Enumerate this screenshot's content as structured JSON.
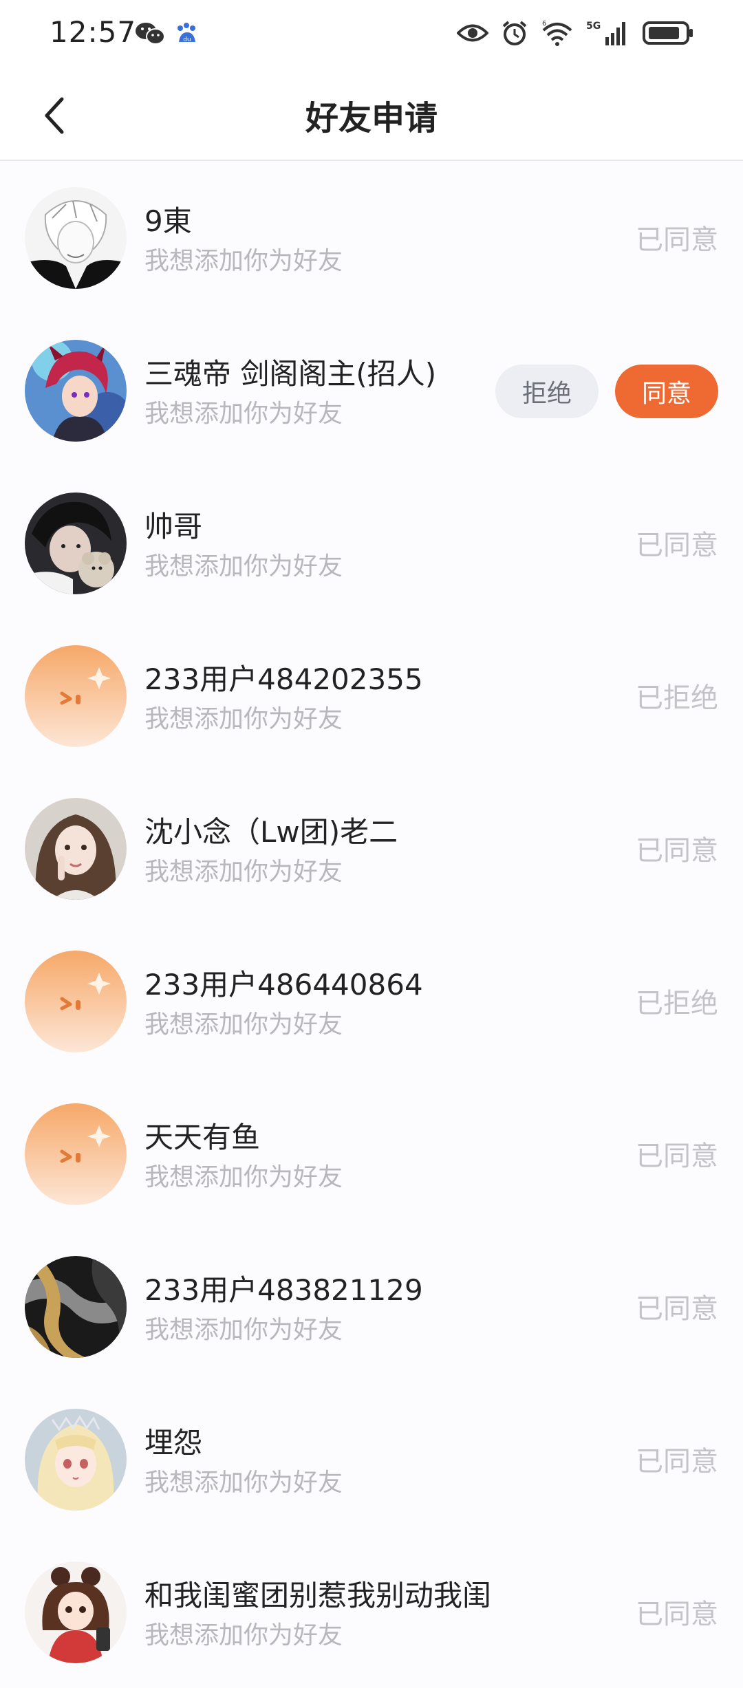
{
  "status_bar": {
    "time": "12:57",
    "network": "5G",
    "wifi_badge": "6"
  },
  "header": {
    "title": "好友申请"
  },
  "requests": [
    {
      "name": "9東",
      "message": "我想添加你为好友",
      "status": "已同意",
      "avatar": "sketch-avatar"
    },
    {
      "name": "三魂帝 剑阁阁主(招人)",
      "message": "我想添加你为好友",
      "status": "",
      "avatar": "anime-avatar-redhair",
      "actions": {
        "reject": "拒绝",
        "accept": "同意"
      }
    },
    {
      "name": "帅哥",
      "message": "我想添加你为好友",
      "status": "已同意",
      "avatar": "photo-avatar-teddy"
    },
    {
      "name": "233用户484202355",
      "message": "我想添加你为好友",
      "status": "已拒绝",
      "avatar": "default-avatar"
    },
    {
      "name": "沈小念（Lw团)老二",
      "message": "我想添加你为好友",
      "status": "已同意",
      "avatar": "photo-avatar-girl"
    },
    {
      "name": "233用户486440864",
      "message": "我想添加你为好友",
      "status": "已拒绝",
      "avatar": "default-avatar"
    },
    {
      "name": "天天有鱼",
      "message": "我想添加你为好友",
      "status": "已同意",
      "avatar": "default-avatar"
    },
    {
      "name": "233用户483821129",
      "message": "我想添加你为好友",
      "status": "已同意",
      "avatar": "marble-avatar"
    },
    {
      "name": "埋怨",
      "message": "我想添加你为好友",
      "status": "已同意",
      "avatar": "anime-avatar-blonde"
    },
    {
      "name": "和我闺蜜团别惹我别动我闺",
      "message": "我想添加你为好友",
      "status": "已同意",
      "avatar": "chibi-avatar"
    }
  ],
  "colors": {
    "accept": "#ee6a32",
    "reject_bg": "#eceef3",
    "muted_text": "#b8b8bc",
    "status_text": "#c4c4c8",
    "default_avatar": "#f7a86a"
  }
}
